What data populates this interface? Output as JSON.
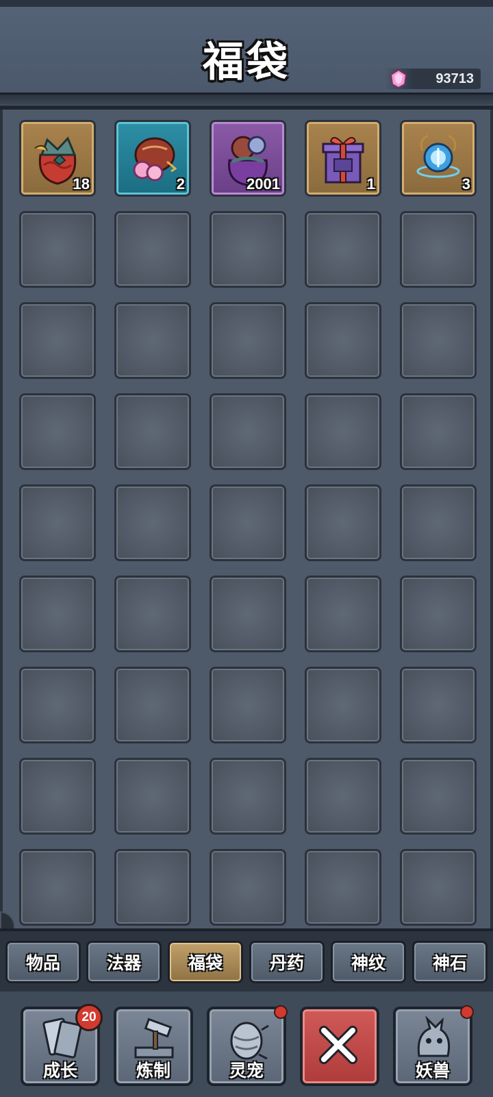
{
  "header": {
    "title": "福袋",
    "currency": {
      "icon": "pink-gem-icon",
      "amount": "93713"
    }
  },
  "items": [
    {
      "name": "red-lucky-bag",
      "count": "18",
      "frame": "gold"
    },
    {
      "name": "peach-pouch",
      "count": "2",
      "frame": "blue"
    },
    {
      "name": "purple-treasure-bag",
      "count": "2001",
      "frame": "purple"
    },
    {
      "name": "gift-box",
      "count": "1",
      "frame": "gold"
    },
    {
      "name": "spirit-orb",
      "count": "3",
      "frame": "gold"
    }
  ],
  "tabs": [
    {
      "label": "物品",
      "active": false
    },
    {
      "label": "法器",
      "active": false
    },
    {
      "label": "福袋",
      "active": true
    },
    {
      "label": "丹药",
      "active": false
    },
    {
      "label": "神纹",
      "active": false
    },
    {
      "label": "神石",
      "active": false
    }
  ],
  "nav": [
    {
      "label": "成长",
      "badge": "20",
      "icon": "growth-cards-icon"
    },
    {
      "label": "炼制",
      "dot": true,
      "icon": "forge-hammer-icon"
    },
    {
      "label": "灵宠",
      "dot": true,
      "icon": "spirit-pet-egg-icon"
    },
    {
      "label": "",
      "icon": "close-x-icon"
    },
    {
      "label": "妖兽",
      "dot": true,
      "icon": "demon-beast-icon"
    }
  ],
  "colors": {
    "accent": "#c1a06a",
    "close": "#c04847",
    "badge": "#d23a2f"
  }
}
